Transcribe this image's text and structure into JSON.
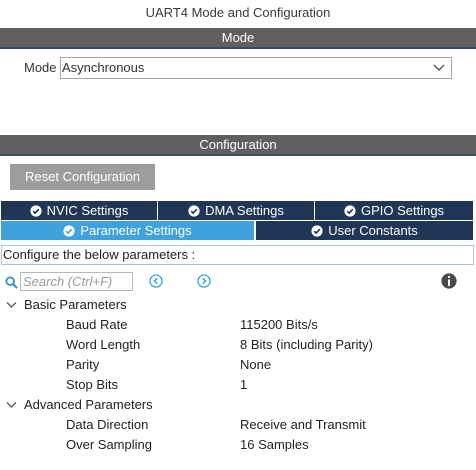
{
  "window": {
    "title": "UART4 Mode and Configuration"
  },
  "mode_section": {
    "header": "Mode",
    "mode_label": "Mode",
    "mode_value": "Asynchronous"
  },
  "config_section": {
    "header": "Configuration",
    "reset_label": "Reset Configuration",
    "tabs": [
      {
        "label": "NVIC Settings",
        "icon": "check-circle-icon"
      },
      {
        "label": "DMA Settings",
        "icon": "check-circle-icon"
      },
      {
        "label": "GPIO Settings",
        "icon": "check-circle-icon"
      },
      {
        "label": "Parameter Settings",
        "icon": "check-circle-icon",
        "active": true
      },
      {
        "label": "User Constants",
        "icon": "check-circle-icon"
      }
    ],
    "description": "Configure the below parameters :",
    "search": {
      "placeholder": "Search (Ctrl+F)"
    },
    "groups": [
      {
        "label": "Basic Parameters",
        "params": [
          {
            "name": "Baud Rate",
            "value": "115200 Bits/s"
          },
          {
            "name": "Word Length",
            "value": "8 Bits (including Parity)"
          },
          {
            "name": "Parity",
            "value": "None"
          },
          {
            "name": "Stop Bits",
            "value": "1"
          }
        ]
      },
      {
        "label": "Advanced Parameters",
        "params": [
          {
            "name": "Data Direction",
            "value": "Receive and Transmit"
          },
          {
            "name": "Over Sampling",
            "value": "16 Samples"
          }
        ]
      }
    ]
  },
  "colors": {
    "section_bar": "#5f5f5f",
    "tab_dark": "#1f3656",
    "tab_active": "#3fa2dc",
    "reset_button": "#9d9d9d",
    "nav_arrow": "#3fa2dc",
    "search_icon": "#2f8fd0"
  }
}
